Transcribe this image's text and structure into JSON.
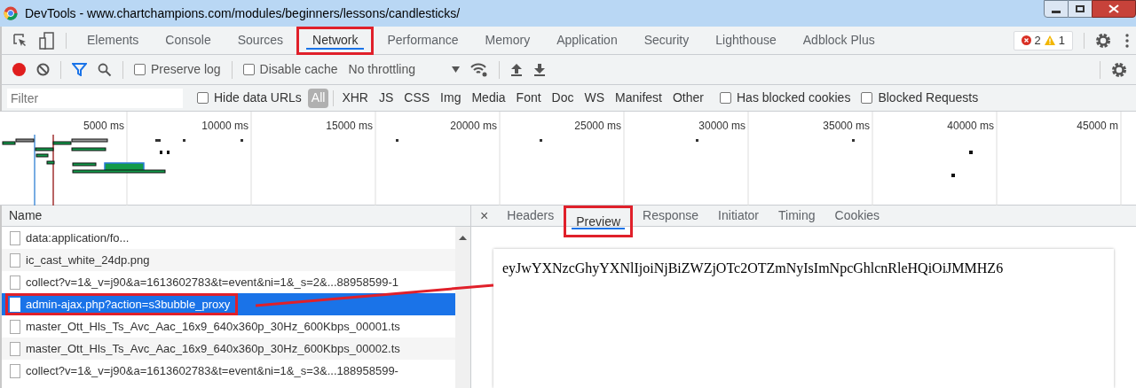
{
  "window": {
    "title": "DevTools - www.chartchampions.com/modules/beginners/lessons/candlesticks/"
  },
  "tabs": [
    {
      "label": "Elements",
      "selected": false,
      "annotated": false
    },
    {
      "label": "Console",
      "selected": false,
      "annotated": false
    },
    {
      "label": "Sources",
      "selected": false,
      "annotated": false
    },
    {
      "label": "Network",
      "selected": true,
      "annotated": true
    },
    {
      "label": "Performance",
      "selected": false,
      "annotated": false
    },
    {
      "label": "Memory",
      "selected": false,
      "annotated": false
    },
    {
      "label": "Application",
      "selected": false,
      "annotated": false
    },
    {
      "label": "Security",
      "selected": false,
      "annotated": false
    },
    {
      "label": "Lighthouse",
      "selected": false,
      "annotated": false
    },
    {
      "label": "Adblock Plus",
      "selected": false,
      "annotated": false
    }
  ],
  "issues": {
    "errors": "2",
    "warnings": "1"
  },
  "toolbar": {
    "recording": true,
    "preserve_log": {
      "label": "Preserve log",
      "checked": false
    },
    "disable_cache": {
      "label": "Disable cache",
      "checked": false
    },
    "throttling": "No throttling"
  },
  "filter_bar": {
    "placeholder": "Filter",
    "hide_data_urls": {
      "label": "Hide data URLs",
      "checked": false
    },
    "types": [
      {
        "label": "All",
        "selected": true
      },
      {
        "label": "XHR",
        "selected": false
      },
      {
        "label": "JS",
        "selected": false
      },
      {
        "label": "CSS",
        "selected": false
      },
      {
        "label": "Img",
        "selected": false
      },
      {
        "label": "Media",
        "selected": false
      },
      {
        "label": "Font",
        "selected": false
      },
      {
        "label": "Doc",
        "selected": false
      },
      {
        "label": "WS",
        "selected": false
      },
      {
        "label": "Manifest",
        "selected": false
      },
      {
        "label": "Other",
        "selected": false
      }
    ],
    "has_blocked_cookies": {
      "label": "Has blocked cookies",
      "checked": false
    },
    "blocked_requests": {
      "label": "Blocked Requests",
      "checked": false
    }
  },
  "timeline": {
    "ticks": [
      "5000 ms",
      "10000 ms",
      "15000 ms",
      "20000 ms",
      "25000 ms",
      "30000 ms",
      "35000 ms",
      "40000 ms",
      "45000 m"
    ]
  },
  "requests": {
    "column": "Name",
    "rows": [
      {
        "name": "data:application/fo...",
        "selected": false,
        "annotated": false
      },
      {
        "name": "ic_cast_white_24dp.png",
        "selected": false,
        "annotated": false
      },
      {
        "name": "collect?v=1&_v=j90&a=1613602783&t=event&ni=1&_s=2&...88958599-1",
        "selected": false,
        "annotated": false
      },
      {
        "name": "admin-ajax.php?action=s3bubble_proxy",
        "selected": true,
        "annotated": true
      },
      {
        "name": "master_Ott_Hls_Ts_Avc_Aac_16x9_640x360p_30Hz_600Kbps_00001.ts",
        "selected": false,
        "annotated": false
      },
      {
        "name": "master_Ott_Hls_Ts_Avc_Aac_16x9_640x360p_30Hz_600Kbps_00002.ts",
        "selected": false,
        "annotated": false
      },
      {
        "name": "collect?v=1&_v=j90&a=1613602783&t=event&ni=1&_s=3&...188958599-",
        "selected": false,
        "annotated": false
      }
    ]
  },
  "detail": {
    "close": "×",
    "tabs": [
      {
        "label": "Headers",
        "selected": false,
        "annotated": false
      },
      {
        "label": "Preview",
        "selected": true,
        "annotated": true
      },
      {
        "label": "Response",
        "selected": false,
        "annotated": false
      },
      {
        "label": "Initiator",
        "selected": false,
        "annotated": false
      },
      {
        "label": "Timing",
        "selected": false,
        "annotated": false
      },
      {
        "label": "Cookies",
        "selected": false,
        "annotated": false
      }
    ],
    "preview": "eyJwYXNzcGhyYXNlIjoiNjBiZWZjOTc2OTZmNyIsImNpcGhlcnRleHQiOiJMMHZ6"
  }
}
